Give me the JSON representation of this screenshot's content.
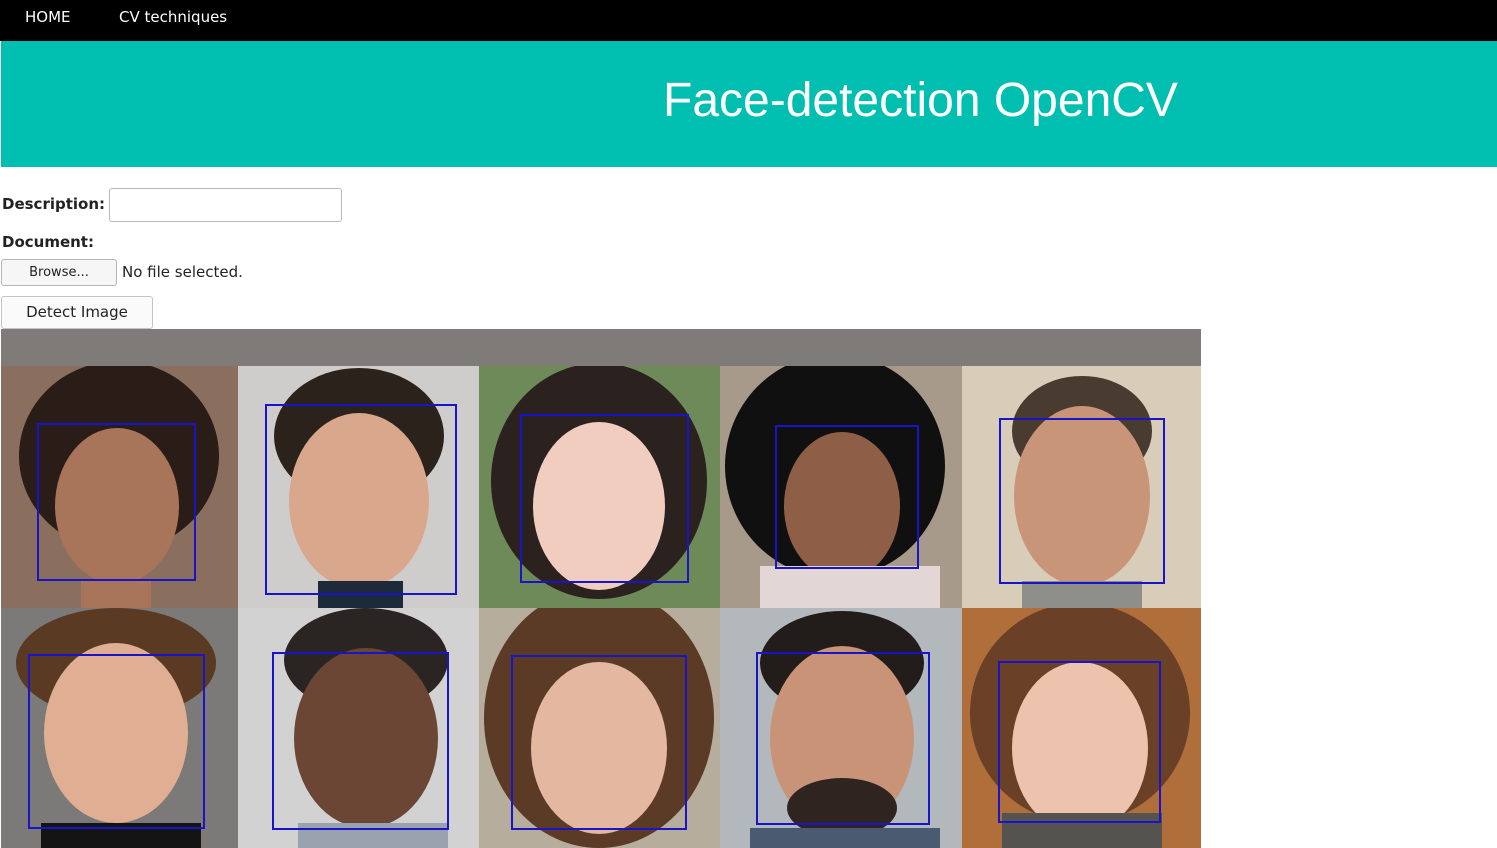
{
  "nav": {
    "items": [
      {
        "label": "HOME"
      },
      {
        "label": "CV techniques"
      }
    ]
  },
  "header": {
    "title": "Face-detection OpenCV"
  },
  "form": {
    "description_label": "Description:",
    "description_value": "",
    "document_label": "Document:",
    "browse_label": "Browse...",
    "file_status": "No file selected.",
    "submit_label": "Detect Image"
  },
  "result_image": {
    "face_count": 10,
    "box_color": "#1a14c8"
  },
  "colors": {
    "nav_bg": "#000000",
    "banner_bg": "#00bfb0",
    "banner_text": "#ffffff"
  }
}
